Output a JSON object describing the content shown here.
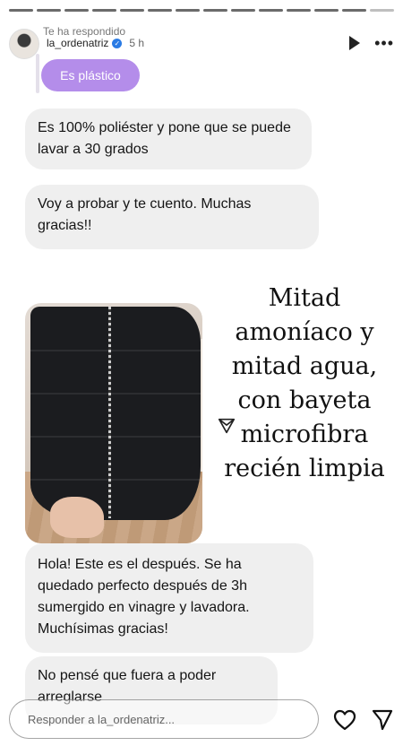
{
  "story": {
    "progress_total": 14,
    "progress_completed": 13
  },
  "header": {
    "replied_label": "Te ha respondido",
    "username": "la_ordenatriz",
    "time": "5 h",
    "icons": [
      "play-icon",
      "more-icon"
    ]
  },
  "replied_message": {
    "text": "Es plástico",
    "color": "#b48dea"
  },
  "messages": [
    {
      "text": "Es 100% poliéster y pone que se puede lavar a 30 grados"
    },
    {
      "text": "Voy a probar y te cuento. Muchas gracias!!"
    },
    {
      "text": "Hola! Este es el después. Se ha quedado perfecto después de 3h sumergido en vinagre y lavadora. Muchísimas gracias!"
    },
    {
      "text": "No pensé que fuera a poder arreglarse"
    }
  ],
  "caption_lines": [
    "Mitad",
    "amoníaco y",
    "mitad agua,",
    "con bayeta",
    "microfibra",
    "recién limpia"
  ],
  "reply_input": {
    "placeholder": "Responder a la_ordenatriz..."
  },
  "footer_icons": [
    "heart-icon",
    "send-icon"
  ]
}
